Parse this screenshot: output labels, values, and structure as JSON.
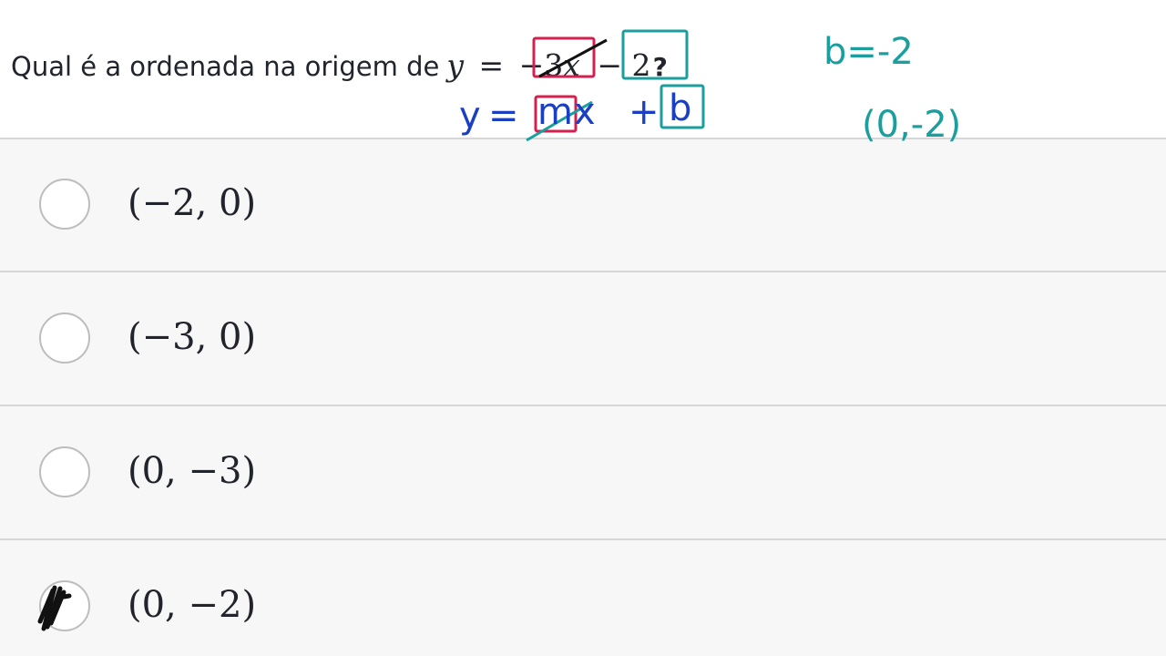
{
  "question": {
    "prefix": "Qual é a ordenada na origem de",
    "equation": {
      "y": "y",
      "equals": "=",
      "coef": "−3",
      "x": "x",
      "const": "− 2",
      "qmark": "?"
    }
  },
  "handwriting": {
    "slope_intercept": {
      "y": "y",
      "equals": "=",
      "m": "m",
      "x": "x",
      "plus": "+",
      "b": "b"
    },
    "b_value": "b=-2",
    "point": "(0,-2)"
  },
  "choices": [
    {
      "label": "(−2, 0)",
      "selected": false
    },
    {
      "label": "(−3, 0)",
      "selected": false
    },
    {
      "label": "(0, −3)",
      "selected": false
    },
    {
      "label": "(0, −2)",
      "selected": true
    }
  ],
  "colors": {
    "ink_red": "#d4204f",
    "ink_teal": "#1a9e9e",
    "ink_blue": "#1a3fc4",
    "ink_black": "#111111",
    "text": "#21242c",
    "divider": "#d6d6d6",
    "radio_border": "#bdbdbd"
  }
}
